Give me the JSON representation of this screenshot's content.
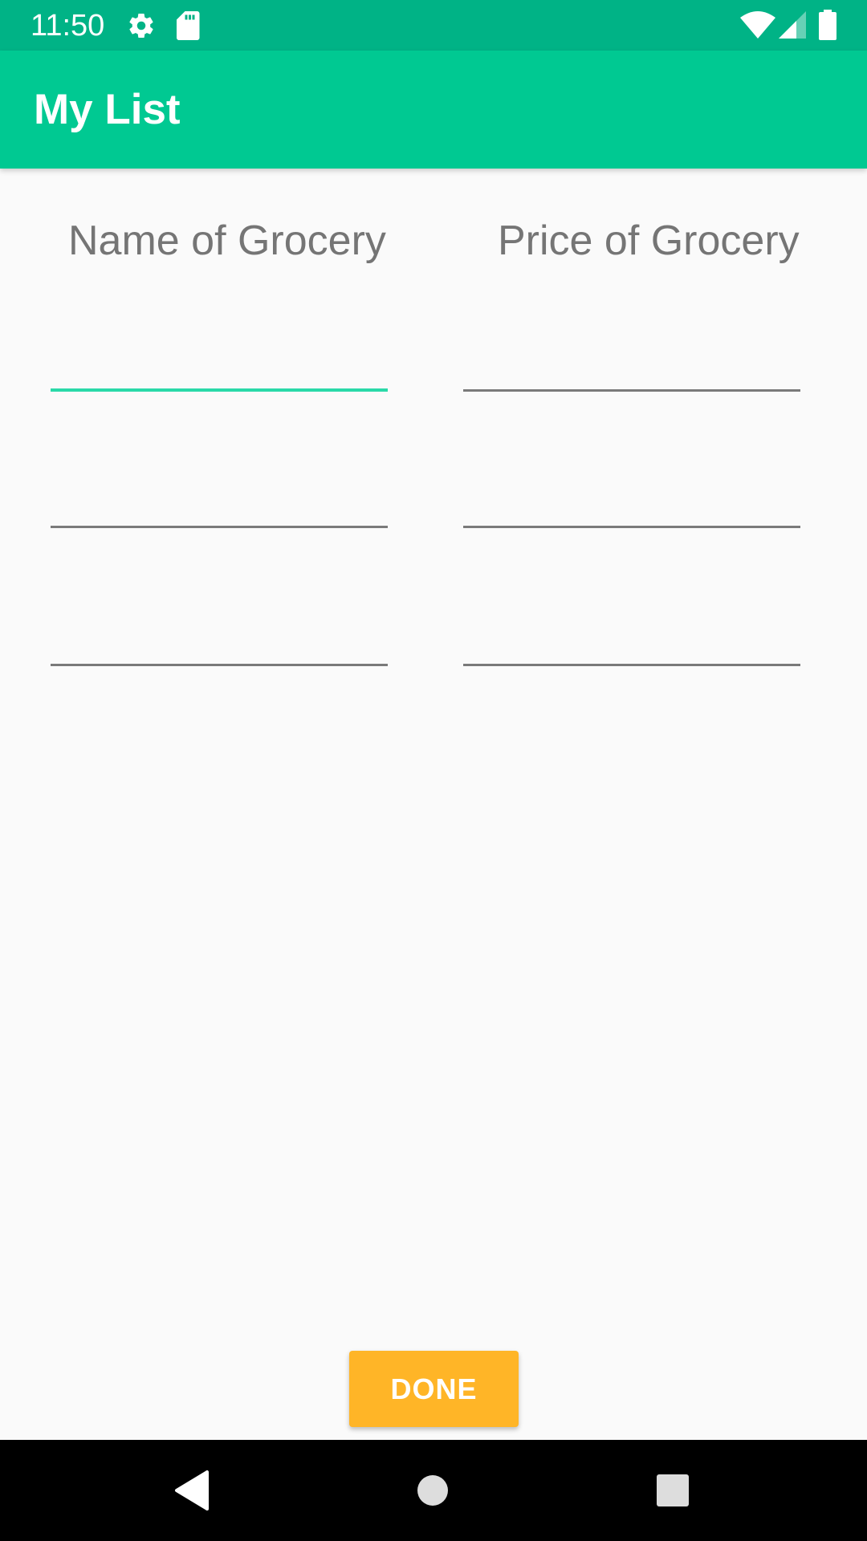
{
  "status_bar": {
    "time": "11:50",
    "background": "#00b386",
    "icons_left": [
      "gear-icon",
      "sd-card-icon"
    ],
    "icons_right": [
      "wifi-icon",
      "cellular-signal-icon",
      "battery-icon"
    ]
  },
  "app_bar": {
    "title": "My List",
    "background": "#00c992"
  },
  "columns": {
    "name_header": "Name of Grocery",
    "price_header": "Price of Grocery"
  },
  "rows": [
    {
      "name": "",
      "price": "",
      "name_focused": true
    },
    {
      "name": "",
      "price": "",
      "name_focused": false
    },
    {
      "name": "",
      "price": "",
      "name_focused": false
    }
  ],
  "done_button": {
    "label": "DONE",
    "color": "#ffb527"
  },
  "nav_bar": {
    "buttons": [
      "back-icon",
      "home-icon",
      "recents-icon"
    ]
  },
  "accent_color": "#2ad9a8"
}
